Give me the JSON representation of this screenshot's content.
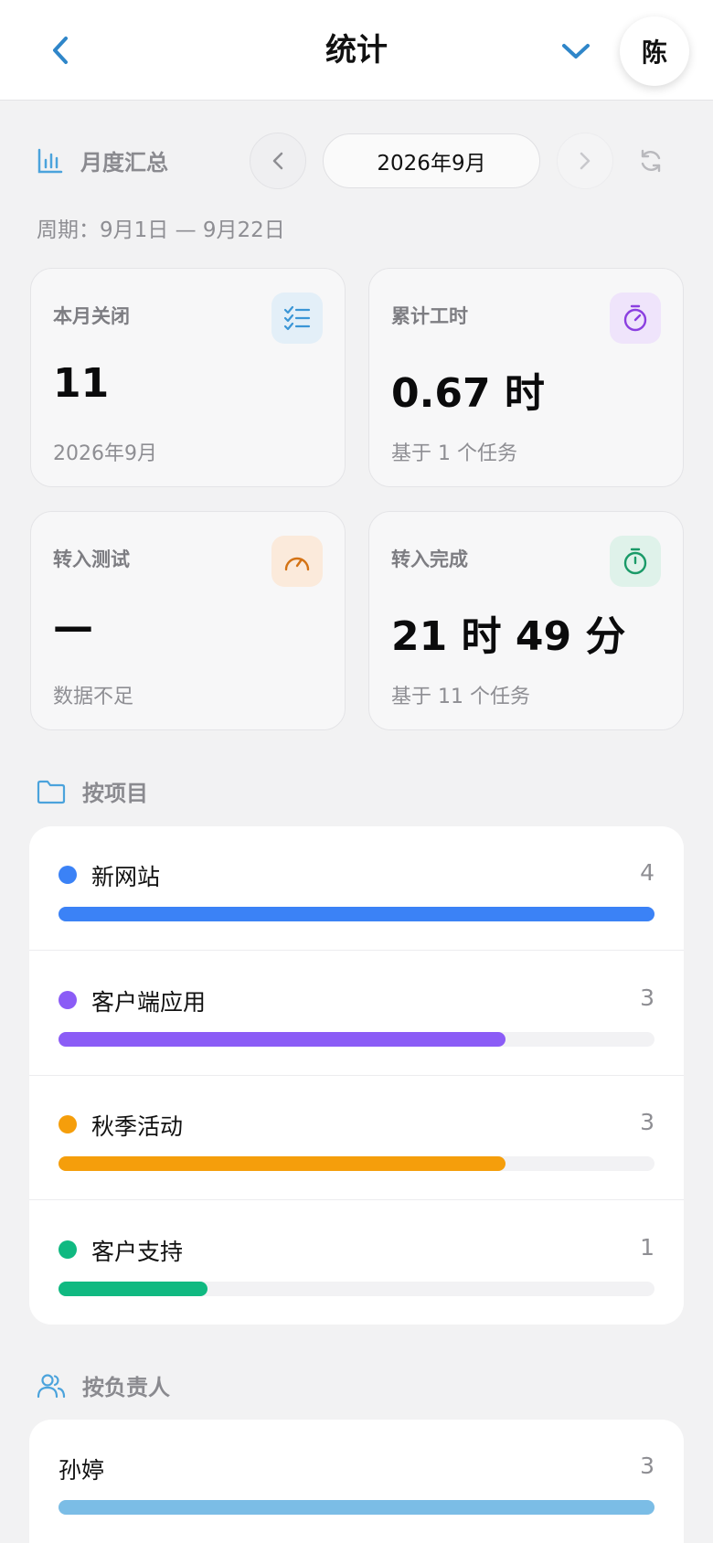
{
  "header": {
    "title": "统计",
    "avatar_initial": "陈"
  },
  "summary": {
    "label": "月度汇总",
    "month": "2026年9月",
    "period": "周期：9月1日 — 9月22日"
  },
  "cards": [
    {
      "title": "本月关闭",
      "value": "11",
      "sub": "2026年9月",
      "icon": "checklist-icon",
      "accent": "#3b96d6",
      "bg": "#e3eff8"
    },
    {
      "title": "累计工时",
      "value": "0.67 时",
      "sub": "基于 1 个任务",
      "icon": "stopwatch-icon",
      "accent": "#8b3fe0",
      "bg": "#efe4fb"
    },
    {
      "title": "转入测试",
      "value": "—",
      "sub": "数据不足",
      "icon": "speedometer-icon",
      "accent": "#d47315",
      "bg": "#fbeadb"
    },
    {
      "title": "转入完成",
      "value": "21 时 49 分",
      "sub": "基于 11 个任务",
      "icon": "timer-icon",
      "accent": "#1a9a68",
      "bg": "#dff2ea"
    }
  ],
  "by_project": {
    "label": "按项目",
    "items": [
      {
        "name": "新网站",
        "count": "4",
        "fraction": 1.0,
        "color": "#3b82f6"
      },
      {
        "name": "客户端应用",
        "count": "3",
        "fraction": 0.75,
        "color": "#8b5cf6"
      },
      {
        "name": "秋季活动",
        "count": "3",
        "fraction": 0.75,
        "color": "#f59e0b"
      },
      {
        "name": "客户支持",
        "count": "1",
        "fraction": 0.25,
        "color": "#10b981"
      }
    ]
  },
  "by_owner": {
    "label": "按负责人",
    "items": [
      {
        "name": "孙婷",
        "count": "3",
        "fraction": 1.0,
        "color": "#7bbde6"
      }
    ]
  }
}
